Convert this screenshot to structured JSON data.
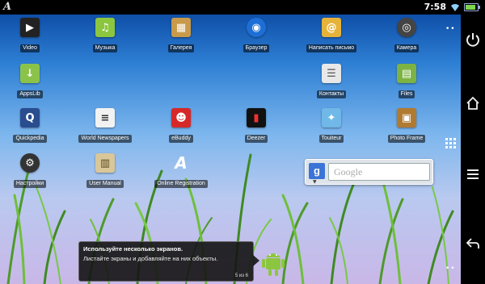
{
  "status_bar": {
    "time": "7:58",
    "logo": "A",
    "battery_level": 0.85,
    "icons": [
      "wifi-icon",
      "battery-icon"
    ]
  },
  "apps": [
    {
      "label": "Video",
      "icon": "video-icon",
      "color": "#222222",
      "glyph": "▶"
    },
    {
      "label": "Музыка",
      "icon": "music-icon",
      "color": "#8cc63f",
      "glyph": "♫"
    },
    {
      "label": "Галерея",
      "icon": "gallery-icon",
      "color": "#c89a4a",
      "glyph": "▦"
    },
    {
      "label": "Браузер",
      "icon": "browser-icon",
      "color": "#1d6fd6",
      "glyph": "◉"
    },
    {
      "label": "Написать письмо",
      "icon": "email-icon",
      "color": "#e6b33a",
      "glyph": "@"
    },
    {
      "label": "Камера",
      "icon": "camera-icon",
      "color": "#444444",
      "glyph": "◎"
    },
    {
      "label": "AppsLib",
      "icon": "appslib-icon",
      "color": "#8bc34a",
      "glyph": "↓"
    },
    {
      "label": "Контакты",
      "icon": "contacts-icon",
      "color": "#e8e8e8",
      "glyph": "☰"
    },
    {
      "label": "Files",
      "icon": "files-icon",
      "color": "#7cb342",
      "glyph": "▤"
    },
    {
      "label": "Quickpedia",
      "icon": "quickpedia-icon",
      "color": "#2a4d8f",
      "glyph": "Q"
    },
    {
      "label": "World Newspapers",
      "icon": "newspapers-icon",
      "color": "#f2f2f2",
      "glyph": "≡"
    },
    {
      "label": "eBuddy",
      "icon": "ebuddy-icon",
      "color": "#d62828",
      "glyph": "☻"
    },
    {
      "label": "Deezer",
      "icon": "deezer-icon",
      "color": "#111111",
      "glyph": "▮"
    },
    {
      "label": "Touiteur",
      "icon": "touiteur-icon",
      "color": "#6fb8e8",
      "glyph": "✦"
    },
    {
      "label": "Photo Frame",
      "icon": "photo-frame-icon",
      "color": "#b07a30",
      "glyph": "▣"
    },
    {
      "label": "Настройки",
      "icon": "settings-icon",
      "color": "#333333",
      "glyph": "⚙"
    },
    {
      "label": "User Manual",
      "icon": "user-manual-icon",
      "color": "#d9c79a",
      "glyph": "▥"
    },
    {
      "label": "Online Registration",
      "icon": "online-registration-icon",
      "color": "#2c6fd8",
      "glyph": "A"
    }
  ],
  "google_widget": {
    "placeholder": "Google",
    "logo": "g"
  },
  "tooltip": {
    "title": "Используйте несколько экранов.",
    "body": "Листайте экраны и добавляйте на них объекты.",
    "page": "5 из 6"
  },
  "nav_buttons": [
    "power-icon",
    "home-icon",
    "menu-icon",
    "back-icon"
  ]
}
